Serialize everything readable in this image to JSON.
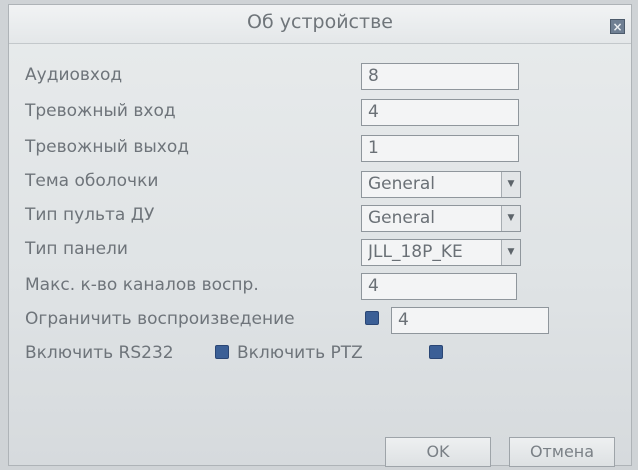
{
  "dialog": {
    "title": "Об устройстве",
    "close_label": "×",
    "colors": {
      "checkbox": "#3b5f96",
      "text": "#6e747a"
    }
  },
  "fields": {
    "audio_in": {
      "label": "Аудиовход",
      "value": "8"
    },
    "alarm_in": {
      "label": "Тревожный вход",
      "value": "4"
    },
    "alarm_out": {
      "label": "Тревожный выход",
      "value": "1"
    },
    "theme": {
      "label": "Тема оболочки",
      "value": "General"
    },
    "remote_type": {
      "label": "Тип пульта ДУ",
      "value": "General"
    },
    "panel_type": {
      "label": "Тип панели",
      "value": "JLL_18P_KE"
    },
    "max_playback": {
      "label": "Макс. к-во каналов воспр.",
      "value": "4"
    },
    "limit_playback": {
      "label": "Ограничить воспроизведение",
      "value": "4"
    },
    "rs232": {
      "label": "Включить RS232"
    },
    "ptz": {
      "label": "Включить PTZ"
    }
  },
  "buttons": {
    "ok": "OK",
    "cancel": "Отмена"
  },
  "icons": {
    "dropdown": "▼"
  }
}
